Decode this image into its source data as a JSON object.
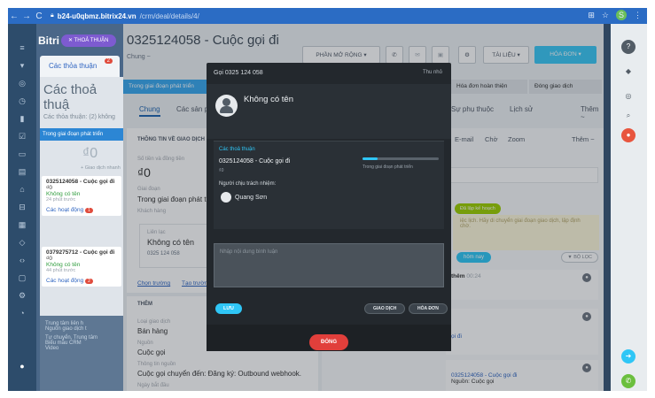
{
  "browser": {
    "host": "b24-u0qbmz.bitrix24.vn",
    "path": "/crm/deal/details/4/",
    "profile": "S"
  },
  "left_panel": {
    "brand": "Bitri",
    "pill": "THOẢ THUẬN",
    "tab": "Các thỏa thuận",
    "tab_badge": "2",
    "title": "Các thoả thuậ",
    "subtitle": "Các thỏa thuận: (2) không",
    "stage": "Trong giai đoạn phát triển",
    "sum": "₫0",
    "add_hint": "+ Giao dịch nhanh",
    "cards": [
      {
        "name": "0325124058 - Cuộc gọi đi",
        "amount": "₫0",
        "contact": "Không có tên",
        "time": "24 phút trước",
        "activity": "Các hoạt động",
        "badge": "1"
      },
      {
        "name": "0379275712 - Cuộc gọi đi",
        "amount": "₫0",
        "contact": "Không có tên",
        "time": "44 phút trước",
        "activity": "Các hoạt động",
        "badge": "2"
      }
    ],
    "footer_lines": [
      "Trung tâm liên h",
      "Nguồn giao dịch t",
      "Tự chuyển, Trung tâm",
      "Biểu mẫu CRM",
      "Video"
    ]
  },
  "deal": {
    "title": "0325124058 - Cuộc gọi đi",
    "subtitle": "Chung ~",
    "btn_extensions": "PHẦN MỞ RỘNG",
    "btn_docs": "TÀI LIỆU",
    "btn_invoice": "HÓA ĐƠN",
    "stages": [
      "Trong giai đoạn phát triển",
      "Hóa đơn hoàn thiện",
      "Đóng giao dịch"
    ],
    "tabs": [
      "Chung",
      "Các sản phẩ",
      "Sự phụ thuộc",
      "Lịch sử",
      "Thêm ~"
    ],
    "info_header": "THÔNG TIN VỀ GIAO DỊCH",
    "fields": [
      {
        "label": "Số tiền và đồng tiền",
        "value": "₫0"
      },
      {
        "label": "Giai đoạn",
        "value": "Trong giai đoạn phát triển"
      },
      {
        "label": "Khách hàng",
        "value": ""
      }
    ],
    "customer": {
      "label": "Liên lạc",
      "name": "Không có tên",
      "phone": "0325 124 058"
    },
    "links": [
      "Chọn trường",
      "Tạo trường"
    ],
    "more_header": "THÊM",
    "more_fields": [
      {
        "label": "Loại giao dịch",
        "value": "Bán hàng"
      },
      {
        "label": "Nguồn",
        "value": "Cuộc gọi"
      },
      {
        "label": "Thông tin nguồn",
        "value": "Cuộc gọi chuyển đến: Đăng ký: Outbound webhook."
      },
      {
        "label": "Ngày bắt đầu",
        "value": ""
      }
    ],
    "right_tabs": [
      "E-mail",
      "Chờ",
      "Zoom",
      "Thêm ~"
    ],
    "todo": "Đã lập kế hoạch",
    "yellow_note": "iệc lịch. Hãy di chuyển giai đoạn giao dịch, lập định chờ.",
    "today": "hôm nay",
    "filter": "BỘ LỌC",
    "activities": [
      {
        "title": "thêm",
        "time": "00:24"
      },
      {
        "title": "ọi đi",
        "time": ""
      },
      {
        "title": "0325124058 - Cuộc gọi đi",
        "time": "",
        "source": "Nguồn: Cuộc gọi"
      }
    ]
  },
  "modal": {
    "title": "Gọi 0325 124 058",
    "minimize": "Thu nhỏ",
    "contact_name": "Không có tên",
    "deal_header": "Các thoả thuận",
    "deal_name": "0325124058 - Cuộc gọi đi",
    "deal_amount": "₫0",
    "deal_progress": 0.2,
    "deal_stage": "Trong giai đoạn phát triển",
    "responsible_label": "Người chịu trách nhiệm:",
    "responsible_name": "Quang Sơn",
    "comment_placeholder": "Nhập nội dung bình luận",
    "btn_save": "LƯU",
    "btn_deal": "GIAO DỊCH",
    "btn_invoice": "HÓA ĐƠN",
    "btn_close": "ĐÓNG"
  }
}
